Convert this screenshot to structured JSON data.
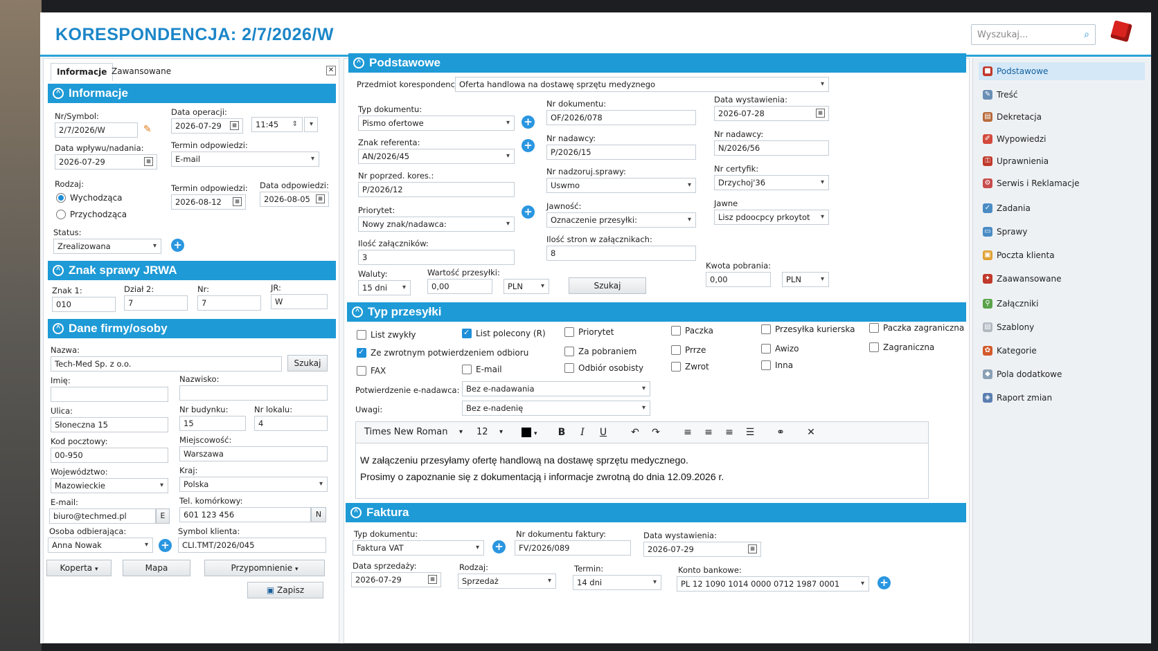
{
  "app": {
    "title": "KORESPONDENCJA: 2/7/2026/W",
    "search_placeholder": "Wyszukaj..."
  },
  "left": {
    "tabs": [
      "Informacje",
      "Zawansowane"
    ],
    "sec_info": "Informacje",
    "nr_symbol_label": "Nr/Symbol:",
    "nr_symbol": "2/7/2026/W",
    "data_operacji_label": "Data operacji:",
    "data_operacji": "2026-07-29",
    "czas": "11:45",
    "data_wplywu_label": "Data wpływu/nadania:",
    "data_wplywu": "2026-07-29",
    "termin_label": "Termin odpowiedzi:",
    "termin_value": "E-mail",
    "rodzaj_label": "Rodzaj:",
    "rodzaj_out": "Wychodząca",
    "rodzaj_in": "Przychodząca",
    "termin2_label": "Termin odpowiedzi:",
    "termin2": "2026-08-12",
    "data_odp_label": "Data odpowiedzi:",
    "data_odp": "2026-08-05",
    "status_label": "Status:",
    "status": "Zrealizowana",
    "sec_jrwa": "Znak sprawy JRWA",
    "znak1_label": "Znak 1:",
    "znak1": "010",
    "dzial2_label": "Dział 2:",
    "dzial2": "7",
    "nr_label": "Nr:",
    "nr": "7",
    "jr_label": "JR:",
    "jr": "W",
    "sec_firma": "Dane firmy/osoby",
    "nazwa_label": "Nazwa:",
    "nazwa": "Tech-Med Sp. z o.o.",
    "szukaj": "Szukaj",
    "imie_label": "Imię:",
    "nazwisko_label": "Nazwisko:",
    "ulica_label": "Ulica:",
    "ulica": "Słoneczna 15",
    "nr_budynku_label": "Nr budynku:",
    "nr_budynku": "15",
    "nr_lokalu_label": "Nr lokalu:",
    "nr_lokalu": "4",
    "kod_label": "Kod pocztowy:",
    "kod": "00-950",
    "miejsc_label": "Miejscowość:",
    "miejsc": "Warszawa",
    "woj_label": "Województwo:",
    "woj": "Mazowieckie",
    "kraj_label": "Kraj:",
    "kraj": "Polska",
    "email_label": "E-mail:",
    "email": "biuro@techmed.pl",
    "email_btn": "E",
    "tel_label": "Tel. komórkowy:",
    "tel": "601 123 456",
    "tel_btn": "N",
    "osoba_label": "Osoba odbierająca:",
    "osoba": "Anna Nowak",
    "symbol_label": "Symbol klienta:",
    "symbol": "CLI.TMT/2026/045",
    "koperta": "Koperta",
    "mapa": "Mapa",
    "przypomnienie": "Przypomnienie",
    "zapisz": "Zapisz"
  },
  "podst": {
    "title": "Podstawowe",
    "przedmiot_label": "Przedmiot korespondencji:",
    "przedmiot": "Oferta handlowa na dostawę sprzętu medyznego",
    "typ_label": "Typ dokumentu:",
    "typ": "Pismo ofertowe",
    "nrdok_label": "Nr dokumentu:",
    "nrdok": "OF/2026/078",
    "datawyst_label": "Data wystawienia:",
    "datawyst": "2026-07-28",
    "znakref_label": "Znak referenta:",
    "znakref": "AN/2026/45",
    "nrnad_label": "Nr nadawcy:",
    "nrnad": "P/2026/15",
    "nrnad2_label": "Nr nadawcy:",
    "nrnad2": "N/2026/56",
    "nrpop_label": "Nr poprzed. kores.:",
    "nrpop": "P/2026/12",
    "nrnadz_label": "Nr nadzoruj.sprawy:",
    "nrnadz": "Uswmo",
    "nrcert_label": "Nr certyfik:",
    "nrcert": "Drzychoj'36",
    "prio_label": "Priorytet:",
    "prio": "Nowy znak/nadawca:",
    "jawnosc_label": "Jawność:",
    "jawnosc": "Oznaczenie przesyłki:",
    "jawne_label": "Jawne",
    "jawne": "Lisz pdoocpcy prkoytot",
    "ilosc_label": "Ilość załączników:",
    "ilosc": "3",
    "ilstr_label": "Ilość stron w załącznikach:",
    "ilstr": "8",
    "waluty_label": "Waluty:",
    "waluty": "15 dni",
    "wart_label": "Wartość przesyłki:",
    "wart": "0,00",
    "wart_cur": "PLN",
    "szukaj": "Szukaj",
    "kwota_label": "Kwota pobrania:",
    "kwota": "0,00",
    "kwota_cur": "PLN"
  },
  "typ": {
    "title": "Typ przesyłki",
    "checks": [
      {
        "label": "List zwykły",
        "on": false
      },
      {
        "label": "List polecony (R)",
        "on": true
      },
      {
        "label": "Priorytet",
        "on": false
      },
      {
        "label": "Paczka",
        "on": false
      },
      {
        "label": "Przesyłka kurierska",
        "on": false
      },
      {
        "label": "Paczka zagraniczna",
        "on": false
      },
      {
        "label": "Ze zwrotnym potwierdzeniem odbioru",
        "on": true
      },
      {
        "label": "Za pobraniem",
        "on": false
      },
      {
        "label": "Prrze",
        "on": false
      },
      {
        "label": "Awizo",
        "on": false
      },
      {
        "label": "Zagraniczna",
        "on": false
      },
      {
        "label": "FAX",
        "on": false
      },
      {
        "label": "E-mail",
        "on": false
      },
      {
        "label": "Odbiór osobisty",
        "on": false
      },
      {
        "label": "Zwrot",
        "on": false
      },
      {
        "label": "Inna",
        "on": false
      }
    ],
    "potw_label": "Potwierdzenie e-nadawca:",
    "potw": "Bez e-nadawania",
    "uwagi_label": "Uwagi:",
    "uwagi": "Bez e-nadenię",
    "font": "Times New Roman",
    "size": "12",
    "line1": "W załączeniu przesyłamy ofertę handlową na dostawę sprzętu medycznego.",
    "line2": "Prosimy o zapoznanie się z dokumentacją i informacje zwrotną do dnia 12.09.2026 r."
  },
  "fakt": {
    "title": "Faktura",
    "typ_label": "Typ dokumentu:",
    "typ": "Faktura VAT",
    "nr_label": "Nr dokumentu faktury:",
    "nr": "FV/2026/089",
    "dw_label": "Data wystawienia:",
    "dw": "2026-07-29",
    "ds_label": "Data sprzedaży:",
    "ds": "2026-07-29",
    "rodzaj_label": "Rodzaj:",
    "rodzaj": "Sprzedaż",
    "termin_label": "Termin:",
    "termin": "14 dni",
    "konto_label": "Konto bankowe:",
    "konto": "PL 12 1090 1014 0000 0712 1987 0001"
  },
  "sidebar": [
    "Podstawowe",
    "Treść",
    "Dekretacja",
    "Wypowiedzi",
    "Uprawnienia",
    "Serwis i Reklamacje",
    "Zadania",
    "Sprawy",
    "Poczta klienta",
    "Zaawansowane",
    "Załączniki",
    "Szablony",
    "Kategorie",
    "Pola dodatkowe",
    "Raport zmian"
  ],
  "colors": {
    "accent": "#1e9ad6",
    "title": "#1b86c8"
  }
}
